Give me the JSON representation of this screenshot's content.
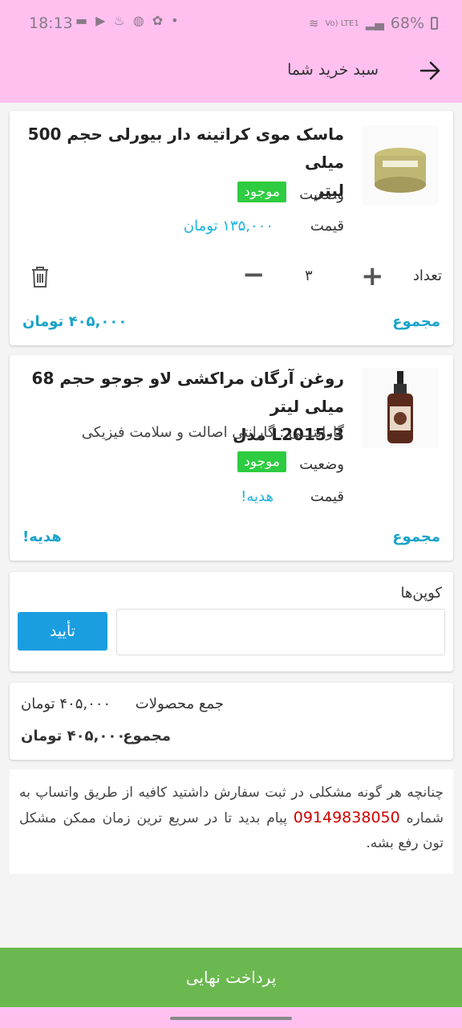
{
  "status_bar": {
    "time": "18:13",
    "battery": "68%",
    "network": "Vo) LTE1"
  },
  "app_bar": {
    "title": "سبد خرید شما"
  },
  "products": [
    {
      "name_line1": "ماسک موی کراتینه دار بیورلی حجم 500 میلی",
      "name_line2": "لیتر",
      "status_label": "وضعیت",
      "status_value": "موجود",
      "price_label": "قیمت",
      "price_value": "۱۳۵,۰۰۰ تومان",
      "qty_label": "تعداد",
      "qty_value": "۳",
      "total_label": "مجموع",
      "total_value": "۴۰۵,۰۰۰ تومان"
    },
    {
      "name_line1": "روغن آرگان مراکشی لاو جوجو حجم 68 میلی لیتر",
      "name_line2": "مدل L2015-3",
      "guarantee": "گارانتـــی : گارانتی اصالت و سلامت فیزیکی",
      "status_label": "وضعیت",
      "status_value": "موجود",
      "price_label": "قیمت",
      "price_value": "هدیه!",
      "total_label": "مجموع",
      "total_value": "هدیه!"
    }
  ],
  "coupon": {
    "label": "کوپن‌ها",
    "placeholder": "",
    "confirm": "تأیید"
  },
  "summary": {
    "subtotal_label": "جمع محصولات",
    "subtotal_value": "۴۰۵,۰۰۰ تومان",
    "total_label": "مجموع",
    "total_value": "۴۰۵,۰۰۰ تومان"
  },
  "notice": {
    "part1": "چنانچه هر گونه مشکلی در ثبت سفارش داشتید کافیه از طریق واتساپ به شماره ",
    "phone": "09149838050",
    "part2": " پیام بدید تا در  سریع ترین زمان ممکن مشکل تون رفع بشه."
  },
  "pay_button": "پرداخت نهایی",
  "colors": {
    "header": "#ffc0f0",
    "in_stock": "#2ecc40",
    "accent": "#1ab2e0",
    "pay": "#6ab84f",
    "confirm": "#1a9ee0",
    "phone": "#d10000"
  }
}
